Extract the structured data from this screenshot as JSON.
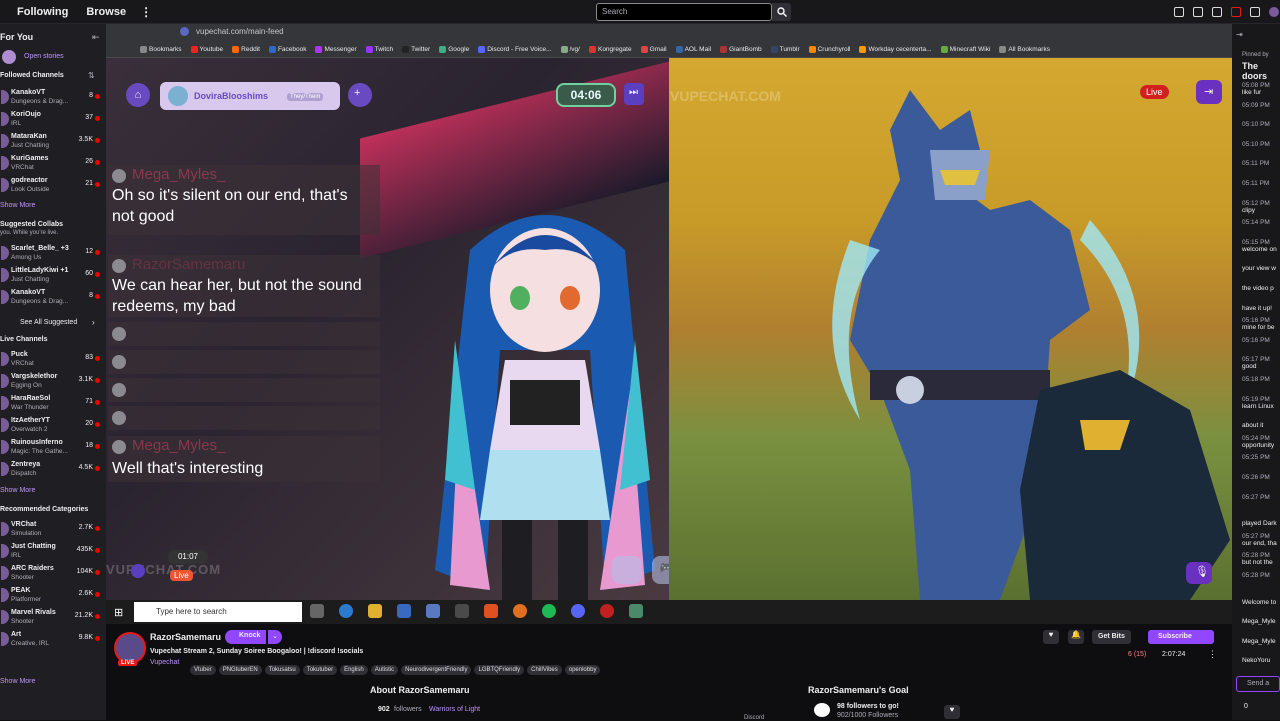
{
  "topnav": {
    "following": "Following",
    "browse": "Browse",
    "search_placeholder": "Search"
  },
  "sidebar": {
    "for_you": "For You",
    "open_stories": "Open stories",
    "followed_title": "Followed Channels",
    "followed": [
      {
        "name": "KanakoVT",
        "game": "Dungeons & Drag...",
        "viewers": "8"
      },
      {
        "name": "KoriOujo",
        "game": "IRL",
        "viewers": "37"
      },
      {
        "name": "MataraKan",
        "game": "Just Chatting",
        "viewers": "3.5K"
      },
      {
        "name": "KuriGames",
        "game": "VRChat",
        "viewers": "26"
      },
      {
        "name": "godreactor",
        "game": "Look Outside",
        "viewers": "21"
      }
    ],
    "show_more1": "Show More",
    "collabs_title": "Suggested Collabs",
    "collabs_sub": "you. While you're live.",
    "collabs": [
      {
        "name": "Scarlet_Belle_ +3",
        "game": "Among Us",
        "viewers": "12"
      },
      {
        "name": "LittleLadyKiwi +1",
        "game": "Just Chatting",
        "viewers": "60"
      },
      {
        "name": "KanakoVT",
        "game": "Dungeons & Drag...",
        "viewers": "8"
      }
    ],
    "see_all": "See All Suggested",
    "live_title": "Live Channels",
    "live": [
      {
        "name": "Puck",
        "game": "VRChat",
        "viewers": "83"
      },
      {
        "name": "Vargskelethor",
        "game": "Egging On",
        "viewers": "3.1K"
      },
      {
        "name": "HaraRaeSol",
        "game": "War Thunder",
        "viewers": "71"
      },
      {
        "name": "ItzAetherYT",
        "game": "Overwatch 2",
        "viewers": "20"
      },
      {
        "name": "RuinousInferno",
        "game": "Magic: The Gathe...",
        "viewers": "18"
      },
      {
        "name": "Zentreya",
        "game": "Dispatch",
        "viewers": "4.5K"
      }
    ],
    "show_more2": "Show More",
    "rec_title": "Recommended Categories",
    "categories": [
      {
        "name": "VRChat",
        "game": "Simulation",
        "viewers": "2.7K"
      },
      {
        "name": "Just Chatting",
        "game": "IRL",
        "viewers": "435K"
      },
      {
        "name": "ARC Raiders",
        "game": "Shooter",
        "viewers": "104K"
      },
      {
        "name": "PEAK",
        "game": "Platformer",
        "viewers": "2.6K"
      },
      {
        "name": "Marvel Rivals",
        "game": "Shooter",
        "viewers": "21.2K"
      },
      {
        "name": "Art",
        "game": "Creative, IRL",
        "viewers": "9.8K"
      }
    ],
    "show_more3": "Show More"
  },
  "browser": {
    "url": "vupechat.com/main-feed",
    "bookmarks": [
      {
        "label": "Bookmarks",
        "color": "#888"
      },
      {
        "label": "Youtube",
        "color": "#e22"
      },
      {
        "label": "Reddit",
        "color": "#f60"
      },
      {
        "label": "Facebook",
        "color": "#36c"
      },
      {
        "label": "Messenger",
        "color": "#a3f"
      },
      {
        "label": "Twitch",
        "color": "#93f"
      },
      {
        "label": "Twitter",
        "color": "#222"
      },
      {
        "label": "Google",
        "color": "#4a8"
      },
      {
        "label": "Discord - Free Voice...",
        "color": "#56f"
      },
      {
        "label": "/vg/",
        "color": "#8a8"
      },
      {
        "label": "Kongregate",
        "color": "#d33"
      },
      {
        "label": "Gmail",
        "color": "#d44"
      },
      {
        "label": "AOL Mail",
        "color": "#36a"
      },
      {
        "label": "GiantBomb",
        "color": "#a33"
      },
      {
        "label": "Tumblr",
        "color": "#346"
      },
      {
        "label": "Crunchyroll",
        "color": "#f80"
      },
      {
        "label": "Workday cecenterta...",
        "color": "#f90"
      },
      {
        "label": "Minecraft Wiki",
        "color": "#6a4"
      },
      {
        "label": "All Bookmarks",
        "color": "#888"
      }
    ]
  },
  "stream": {
    "user_tag": "DoviraBlooshims",
    "pronouns": "They/Them",
    "timer": "04:06",
    "timer_small": "01:07",
    "live": "Live",
    "watermark": "VUPECHAT.COM",
    "chat": [
      {
        "name": "Mega_Myles_",
        "text": "Oh so it's silent on our end, that's not good"
      },
      {
        "name": "RazorSamemaru",
        "text": "We can hear her, but not the sound redeems, my bad"
      },
      {
        "name": "Mega_Myles_",
        "text": "Well that's interesting"
      }
    ],
    "taskbar_search": "Type here to search"
  },
  "right_chat": {
    "pinned": "Pinned by",
    "title": "The doors",
    "lines": [
      {
        "t": "05:08 PM",
        "m": "like fur"
      },
      {
        "t": "05:09 PM",
        "m": ""
      },
      {
        "t": "05:10 PM",
        "m": ""
      },
      {
        "t": "05:10 PM",
        "m": ""
      },
      {
        "t": "05:11 PM",
        "m": ""
      },
      {
        "t": "05:11 PM",
        "m": ""
      },
      {
        "t": "05:12 PM",
        "m": "clipy"
      },
      {
        "t": "05:14 PM",
        "m": ""
      },
      {
        "t": "05:15 PM",
        "m": "welcome on"
      },
      {
        "t": "",
        "m": "your view w"
      },
      {
        "t": "",
        "m": "the video p"
      },
      {
        "t": "",
        "m": "have it up!"
      },
      {
        "t": "05:16 PM",
        "m": "mine for be"
      },
      {
        "t": "05:16 PM",
        "m": ""
      },
      {
        "t": "05:17 PM",
        "m": "good"
      },
      {
        "t": "05:18 PM",
        "m": ""
      },
      {
        "t": "05:19 PM",
        "m": "learn Linux"
      },
      {
        "t": "",
        "m": "about it"
      },
      {
        "t": "05:24 PM",
        "m": "opportunity"
      },
      {
        "t": "05:25 PM",
        "m": ""
      },
      {
        "t": "05:26 PM",
        "m": ""
      },
      {
        "t": "05:27 PM",
        "m": ""
      },
      {
        "t": "",
        "m": "played Dark"
      },
      {
        "t": "05:27 PM",
        "m": "our end, tha"
      },
      {
        "t": "05:28 PM",
        "m": "but not the"
      },
      {
        "t": "05:28 PM",
        "m": ""
      },
      {
        "t": "",
        "m": "Welcome to"
      },
      {
        "t": "",
        "m": "Mega_Myle"
      },
      {
        "t": "",
        "m": "Mega_Myle"
      },
      {
        "t": "",
        "m": "NekoYoru"
      }
    ],
    "send": "Send a",
    "count": "0"
  },
  "channel": {
    "name": "RazorSamemaru",
    "knock": "Knock",
    "live": "LIVE",
    "title": "Vupechat Stream 2, Sunday Soiree Boogaloo! | !discord !socials",
    "category": "Vupechat",
    "tags": [
      "Vtuber",
      "PNGtuberEN",
      "Tokusatsu",
      "Tokutuber",
      "English",
      "Autistic",
      "NeurodivergentFriendly",
      "LGBTQFriendly",
      "ChillVibes",
      "openlobby"
    ],
    "get_bits": "Get Bits",
    "subscribe": "Subscribe",
    "viewers": "6 (15)",
    "uptime": "2:07:24",
    "about": "About RazorSamemaru",
    "followers_count": "902",
    "followers_label": "followers",
    "team": "Warriors of Light",
    "discord": "Discord",
    "goal_title": "RazorSamemaru's Goal",
    "goal_text": "98 followers to go!",
    "goal_progress": "902/1000 Followers",
    "goal_fraction": 0.902
  }
}
